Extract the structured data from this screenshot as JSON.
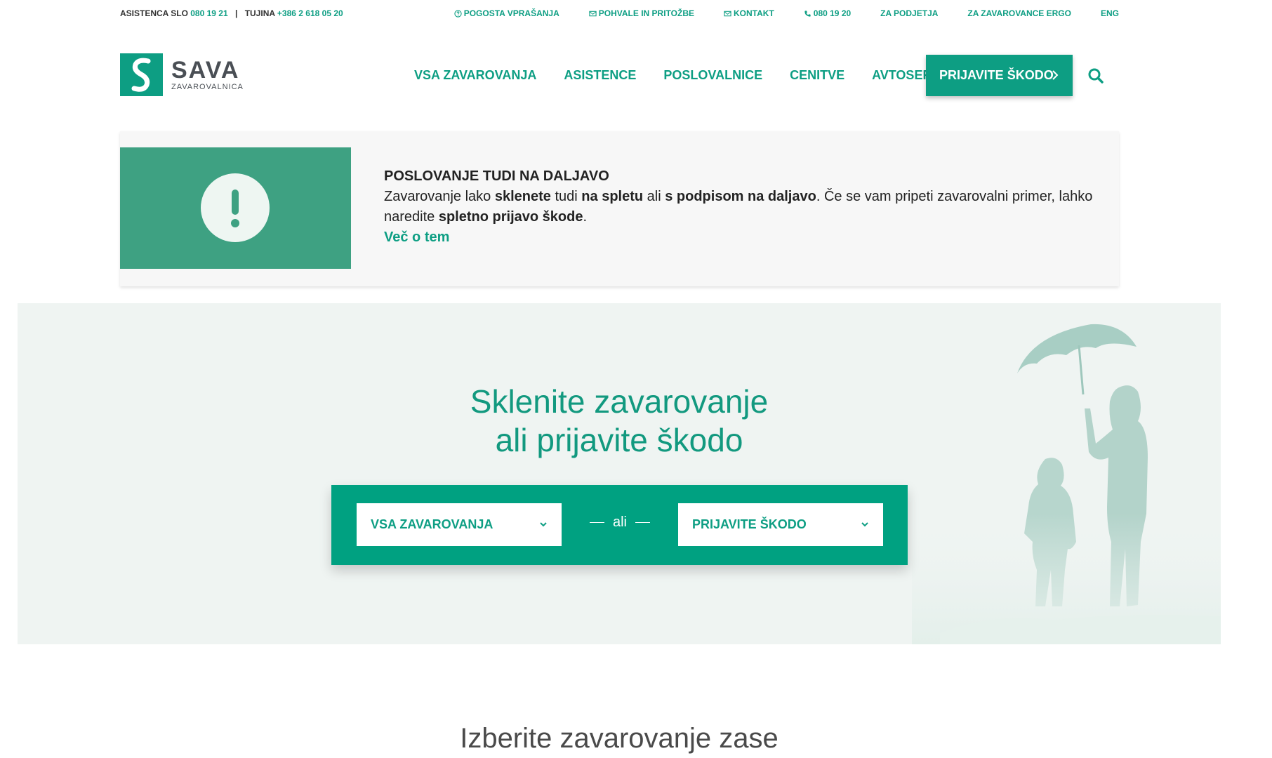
{
  "topbar": {
    "assist_label": "ASISTENCA SLO",
    "assist_number": "080 19 21",
    "separator": "|",
    "abroad_label": "TUJINA",
    "abroad_number": "+386 2 618 05 20",
    "links": [
      {
        "label": "POGOSTA VPRAŠANJA",
        "icon": "question-circle-icon"
      },
      {
        "label": "POHVALE IN PRITOŽBE",
        "icon": "envelope-icon"
      },
      {
        "label": "KONTAKT",
        "icon": "envelope-icon"
      },
      {
        "label": "080 19 20",
        "icon": "phone-icon"
      },
      {
        "label": "ZA PODJETJA"
      },
      {
        "label": "ZA ZAVAROVANCE ERGO"
      },
      {
        "label": "ENG"
      }
    ]
  },
  "logo": {
    "title": "SAVA",
    "subtitle": "ZAVAROVALNICA",
    "brand_color": "#0d9e83"
  },
  "nav": {
    "items": [
      "VSA ZAVAROVANJA",
      "ASISTENCE",
      "POSLOVALNICE",
      "CENITVE",
      "AVTOSERVISI"
    ],
    "cta_label": "PRIJAVITE ŠKODO",
    "search_icon": "search-icon"
  },
  "notice": {
    "title": "POSLOVANJE TUDI NA DALJAVO",
    "text_1": "Zavarovanje lako ",
    "bold_1": "sklenete",
    "text_2": " tudi ",
    "bold_2": "na spletu",
    "text_3": " ali ",
    "bold_3": "s podpisom na daljavo",
    "text_4": ". Če se vam pripeti zavarovalni primer, lahko naredite ",
    "bold_4": "spletno prijavo škode",
    "text_5": ".",
    "more_link": "Več o tem",
    "icon": "exclamation-icon",
    "icon_bg": "#3ea182"
  },
  "hero": {
    "title_line1": "Sklenite zavarovanje",
    "title_line2": "ali prijavite škodo",
    "select_left": "VSA ZAVAROVANJA",
    "or_label": "ali",
    "select_right": "PRIJAVITE ŠKODO",
    "panel_color": "#00a181"
  },
  "section": {
    "title": "Izberite zavarovanje zase"
  }
}
